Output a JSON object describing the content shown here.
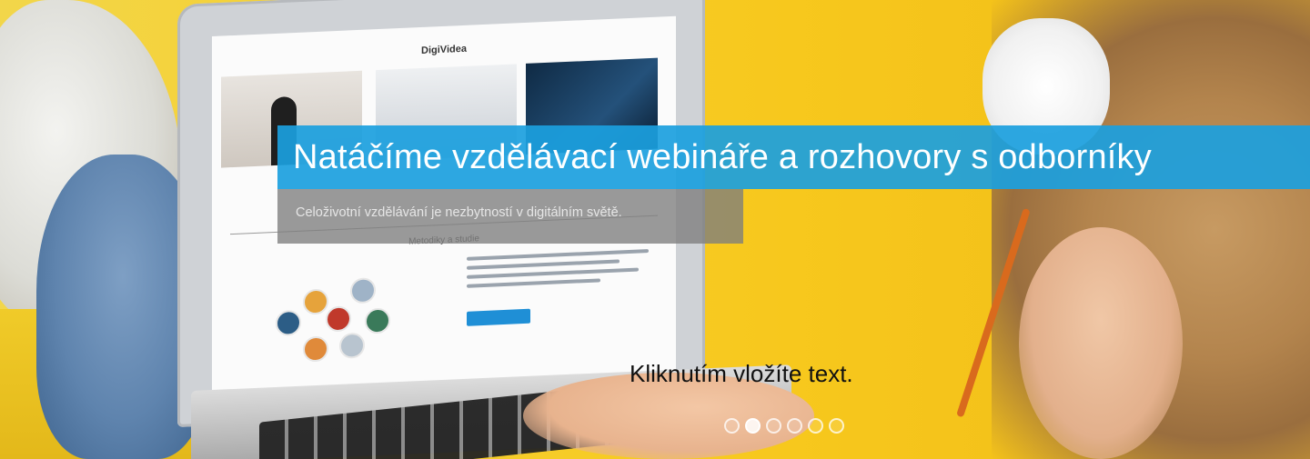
{
  "laptop": {
    "site_title": "DigiVidea",
    "section_title": "Metodiky a studie"
  },
  "banner": {
    "headline": "Natáčíme vzdělávací webináře a rozhovory s odborníky",
    "subline": "Celoživotní vzdělávání je nezbytností v digitálním světě."
  },
  "placeholder_text": "Kliknutím vložíte text.",
  "carousel": {
    "dot_count": 6,
    "active_index": 1
  },
  "colors": {
    "headline_band": "#1ba0de",
    "sub_band": "#7d7d7d",
    "background_yellow": "#f6cf2e"
  }
}
